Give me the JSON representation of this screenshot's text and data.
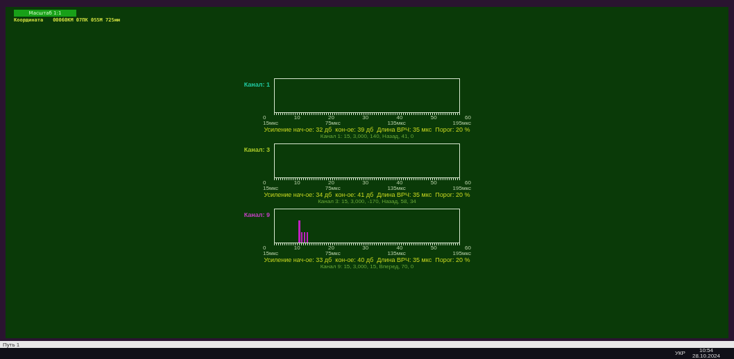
{
  "toolbar": {
    "scale_button": "Масштаб 1:1",
    "coordinate_label": "Координата",
    "coordinate_value": "00060КМ 07ПК 055М 725мм"
  },
  "channels": [
    {
      "label": "Канал: 1",
      "color": "#20c8a0",
      "echo": false,
      "x_ticks": [
        "0",
        "10",
        "20",
        "30",
        "40",
        "50",
        "60"
      ],
      "time_ticks": [
        "15мкс",
        "75мкс",
        "135мкс",
        "195мкс"
      ],
      "info": "Усиление нач-ое: 32 дб  кон-ое: 39 дб  Длина ВРЧ: 35 мкс  Порог: 20 %",
      "details": "Канал 1: 15, 3,000, 140, Назад, 41, 0"
    },
    {
      "label": "Канал: 3",
      "color": "#a8c828",
      "echo": false,
      "x_ticks": [
        "0",
        "10",
        "20",
        "30",
        "40",
        "50",
        "60"
      ],
      "time_ticks": [
        "15мкс",
        "75мкс",
        "135мкс",
        "195мкс"
      ],
      "info": "Усиление нач-ое: 34 дб  кон-ое: 41 дб  Длина ВРЧ: 35 мкс  Порог: 20 %",
      "details": "Канал 3: 15, 3,000, -170, Назад, 58, 34"
    },
    {
      "label": "Канал: 9",
      "color": "#c040c0",
      "echo": true,
      "x_ticks": [
        "0",
        "10",
        "20",
        "30",
        "40",
        "50",
        "60"
      ],
      "time_ticks": [
        "15мкс",
        "75мкс",
        "135мкс",
        "195мкс"
      ],
      "info": "Усиление нач-ое: 33 дб  кон-ое: 40 дб  Длина ВРЧ: 35 мкс  Порог: 20 %",
      "details": "Канал 9: 15, 3,000, 15, Вперед, 70, 0"
    }
  ],
  "status_bar": {
    "text": "Путь 1"
  },
  "taskbar": {
    "language": "УКР",
    "time": "10:54",
    "date": "28.10.2024"
  }
}
